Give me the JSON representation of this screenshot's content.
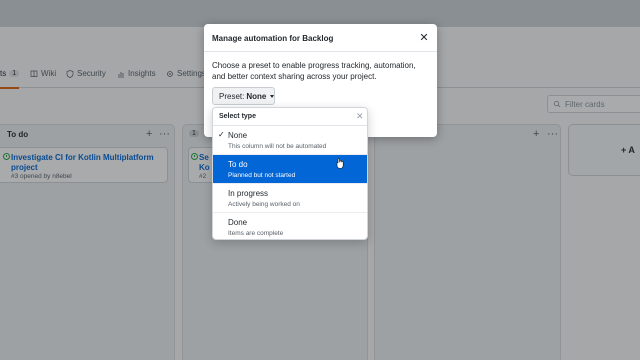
{
  "tabs": [
    {
      "label": "ts",
      "count": "1",
      "icon": "project-icon"
    },
    {
      "label": "Wiki",
      "icon": "book-icon"
    },
    {
      "label": "Security",
      "icon": "shield-icon"
    },
    {
      "label": "Insights",
      "icon": "graph-icon"
    },
    {
      "label": "Settings",
      "icon": "gear-icon"
    }
  ],
  "filter": {
    "placeholder": "Filter cards"
  },
  "columns": [
    {
      "title": "To do",
      "cards": [
        {
          "title": "Investigate CI for Kotlin Multiplatform project",
          "meta": "#3 opened by n8ebel"
        }
      ]
    },
    {
      "title": "",
      "count": "1",
      "cards": [
        {
          "title": "Se Ko",
          "meta": "#2"
        }
      ]
    },
    {
      "title": "",
      "cards": []
    }
  ],
  "add_column": {
    "label": "+ A"
  },
  "modal": {
    "title": "Manage automation for Backlog",
    "description": "Choose a preset to enable progress tracking, automation, and better context sharing across your project.",
    "preset_label": "Preset:",
    "preset_value": "None"
  },
  "dropdown": {
    "title": "Select type",
    "items": [
      {
        "name": "None",
        "desc": "This column will not be automated",
        "checked": true
      },
      {
        "name": "To do",
        "desc": "Planned but not started",
        "selected": true
      },
      {
        "name": "In progress",
        "desc": "Actively being worked on"
      },
      {
        "name": "Done",
        "desc": "Items are complete"
      }
    ]
  },
  "colors": {
    "accent": "#0366d6",
    "overlay": "#1b1f23",
    "issue_open": "#28a745"
  }
}
